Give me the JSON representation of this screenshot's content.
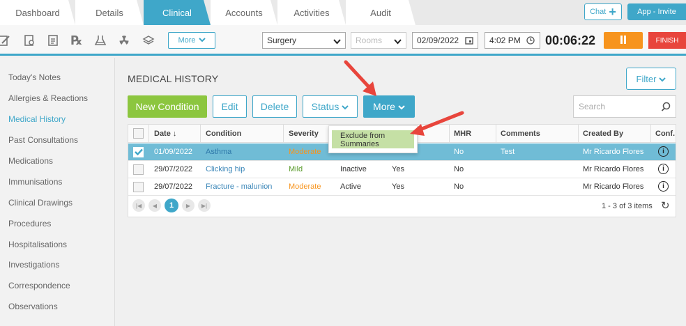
{
  "tabs": [
    {
      "label": "Dashboard",
      "active": false
    },
    {
      "label": "Details",
      "active": false
    },
    {
      "label": "Clinical",
      "active": true
    },
    {
      "label": "Accounts",
      "active": false
    },
    {
      "label": "Activities",
      "active": false
    },
    {
      "label": "Audit",
      "active": false
    }
  ],
  "header": {
    "chat_label": "Chat",
    "app_invite_label": "App - Invite"
  },
  "toolbar": {
    "icons": [
      "notes-icon",
      "prescription-doc-icon",
      "report-icon",
      "rx-icon",
      "lab-flask-icon",
      "radiation-icon",
      "layers-icon"
    ],
    "rx_glyph": "℞",
    "more_label": "More",
    "location_value": "Surgery",
    "rooms_placeholder": "Rooms",
    "date_value": "02/09/2022",
    "time_value": "4:02 PM",
    "timer": "00:06:22",
    "finish_label": "FINISH",
    "pause_color": "#f7941d",
    "finish_color": "#e8453c"
  },
  "sidebar": {
    "items": [
      {
        "label": "Today's Notes"
      },
      {
        "label": "Allergies & Reactions"
      },
      {
        "label": "Medical History",
        "active": true
      },
      {
        "label": "Past Consultations"
      },
      {
        "label": "Medications"
      },
      {
        "label": "Immunisations"
      },
      {
        "label": "Clinical Drawings"
      },
      {
        "label": "Procedures"
      },
      {
        "label": "Hospitalisations"
      },
      {
        "label": "Investigations"
      },
      {
        "label": "Correspondence"
      },
      {
        "label": "Observations"
      }
    ]
  },
  "main": {
    "title": "MEDICAL HISTORY",
    "filter_label": "Filter",
    "buttons": {
      "new_condition": "New Condition",
      "edit": "Edit",
      "delete": "Delete",
      "status": "Status",
      "more": "More"
    },
    "search_placeholder": "Search",
    "columns": {
      "date": "Date",
      "condition": "Condition",
      "severity": "Severity",
      "mhr": "MHR",
      "comments": "Comments",
      "created_by": "Created By",
      "conf": "Conf."
    },
    "rows": [
      {
        "date": "01/09/2022",
        "condition": "Asthma",
        "severity": "Moderate",
        "status": "",
        "active_flag": "",
        "mhr": "No",
        "comments": "Test",
        "created_by": "Mr Ricardo Flores",
        "selected": true
      },
      {
        "date": "29/07/2022",
        "condition": "Clicking hip",
        "severity": "Mild",
        "status": "Inactive",
        "active_flag": "Yes",
        "mhr": "No",
        "comments": "",
        "created_by": "Mr Ricardo Flores",
        "selected": false
      },
      {
        "date": "29/07/2022",
        "condition": "Fracture - malunion",
        "severity": "Moderate",
        "status": "Active",
        "active_flag": "Yes",
        "mhr": "No",
        "comments": "",
        "created_by": "Mr Ricardo Flores",
        "selected": false
      }
    ],
    "pager": {
      "current_page": "1",
      "info": "1 - 3 of 3 items"
    },
    "dropdown": {
      "exclude_label": "Exclude from Summaries"
    }
  },
  "colors": {
    "accent": "#3fa7c9",
    "green": "#8cc63f",
    "annotation_arrow": "#e8453c"
  }
}
